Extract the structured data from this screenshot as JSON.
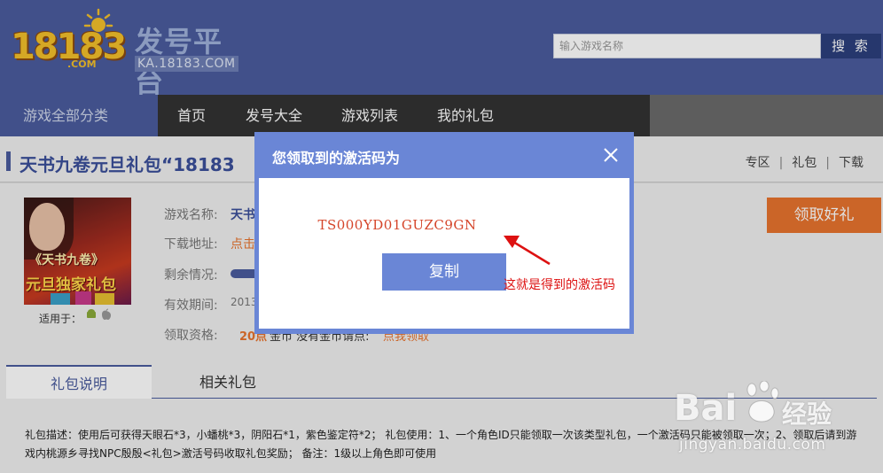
{
  "header": {
    "logo_number": "18183",
    "logo_com": ".COM",
    "logo_title": "发号平台",
    "logo_subtitle": "KA.18183.COM",
    "search_placeholder": "输入游戏名称",
    "search_button": "搜 索"
  },
  "nav": {
    "all_categories": "游戏全部分类",
    "items": [
      "首页",
      "发号大全",
      "游戏列表",
      "我的礼包"
    ]
  },
  "page": {
    "title": "天书九卷元旦礼包“18183",
    "links": [
      "专区",
      "礼包",
      "下载"
    ]
  },
  "gift": {
    "image_text_1": "《天书九卷》",
    "image_text_2": "元旦独家礼包",
    "applies_label": "适用于：",
    "labels": [
      "游戏名称:",
      "下载地址:",
      "剩余情况:",
      "有效期间:",
      "领取资格:"
    ],
    "game_name_partial": "天书",
    "download_partial": "点击",
    "validity_partial": "2013",
    "eligibility_points": "20点",
    "eligibility_text": "金币  没有金币请点:",
    "eligibility_link": "点我领取",
    "claim_button": "领取好礼"
  },
  "tabs": [
    "礼包说明",
    "相关礼包"
  ],
  "description": "礼包描述：使用后可获得天眼石*3，小蟠桃*3，阴阳石*1，紫色鉴定符*2；  礼包使用：1、一个角色ID只能领取一次该类型礼包，一个激活码只能被领取一次；2、领取后请到游戏内桃源乡寻找NPC殷殷<礼包>激活号码收取礼包奖励；  备注：1级以上角色即可使用",
  "modal": {
    "title": "您领取到的激活码为",
    "code": "TS000YD01GUZC9GN",
    "copy_button": "复制"
  },
  "annotation": "这就是得到的激活码",
  "watermark": {
    "brand": "Bai",
    "brand_cn": "经验",
    "url": "jingyan.baidu.com"
  },
  "colors": {
    "brand_blue": "#4a5c9e",
    "modal_blue": "#6a86d6",
    "accent_orange": "#e8732e",
    "code_red": "#d5452a"
  }
}
